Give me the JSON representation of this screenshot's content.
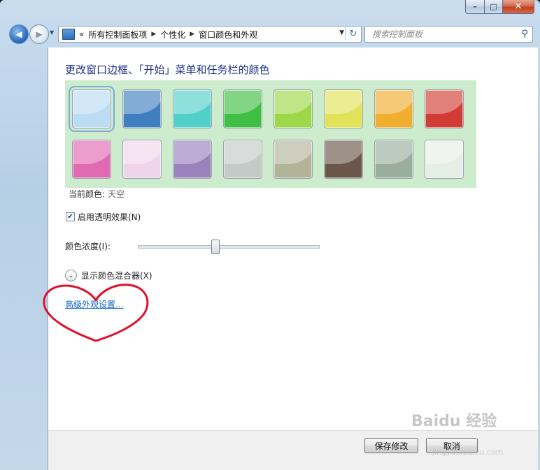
{
  "window": {
    "minimize": "–",
    "maximize": "□",
    "close": "✕"
  },
  "nav": {
    "breadcrumb": {
      "prefix": "«",
      "items": [
        "所有控制面板项",
        "个性化",
        "窗口颜色和外观"
      ]
    },
    "search_placeholder": "搜索控制面板"
  },
  "main": {
    "heading": "更改窗口边框、「开始」菜单和任务栏的颜色",
    "swatches": [
      {
        "name": "sky",
        "color": "#bcdcf3"
      },
      {
        "name": "twilight",
        "color": "#3f7fbf"
      },
      {
        "name": "sea",
        "color": "#50d0c8"
      },
      {
        "name": "leaf",
        "color": "#3fbf44"
      },
      {
        "name": "lime",
        "color": "#9ed84a"
      },
      {
        "name": "lemon",
        "color": "#e2e25a"
      },
      {
        "name": "pumpkin",
        "color": "#f0ad2e"
      },
      {
        "name": "ruby",
        "color": "#d33c34"
      },
      {
        "name": "fuchsia",
        "color": "#e06bb3"
      },
      {
        "name": "blush",
        "color": "#f0d4ec"
      },
      {
        "name": "violet",
        "color": "#9a82bd"
      },
      {
        "name": "lavender",
        "color": "#c4cac8"
      },
      {
        "name": "taupe",
        "color": "#b2b49a"
      },
      {
        "name": "chocolate",
        "color": "#6a5749"
      },
      {
        "name": "slate",
        "color": "#9aae9e"
      },
      {
        "name": "frost",
        "color": "#e6efe6"
      }
    ],
    "selected_index": 0,
    "current_color_label": "当前颜色:",
    "current_color_value": "天空",
    "transparency_label": "启用透明效果(N)",
    "transparency_checked": true,
    "intensity_label": "颜色浓度(I):",
    "intensity_value": 0.42,
    "mixer_label": "显示颜色混合器(X)",
    "advanced_link": "高级外观设置..."
  },
  "footer": {
    "save_label": "保存修改",
    "cancel_label": "取消"
  },
  "watermark": {
    "text": "Baidu 经验",
    "sub": "jingyan.baidu.com"
  },
  "colors": {
    "heading": "#1e3287",
    "link": "#0c65c7",
    "swatch_bg": "#cdeccd",
    "annotation": "#e0102a"
  }
}
